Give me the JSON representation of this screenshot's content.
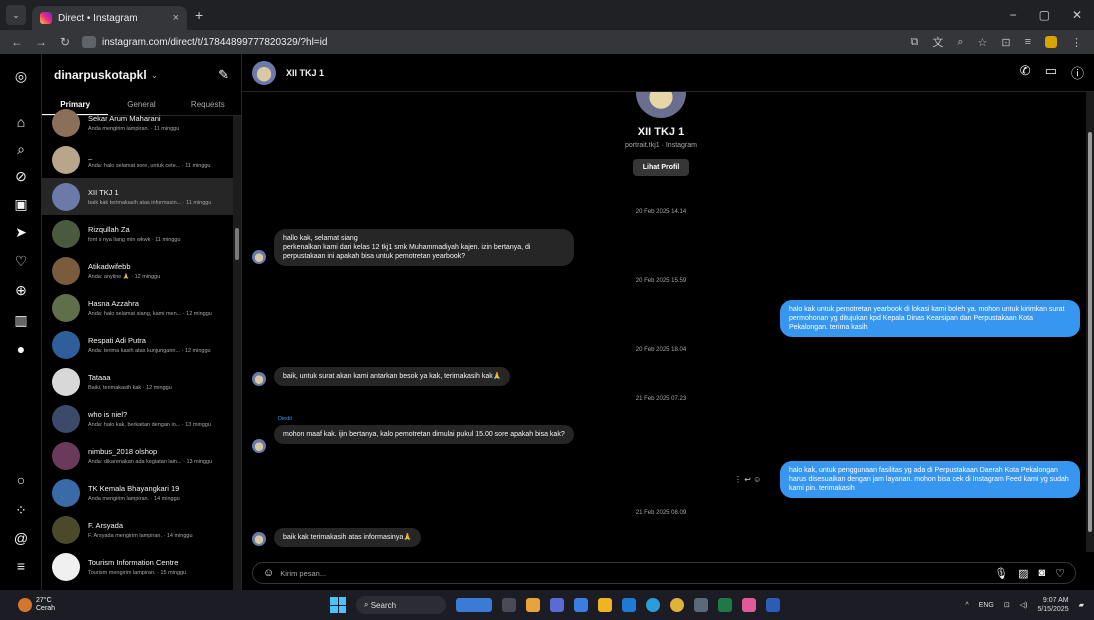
{
  "browser": {
    "tab_title": "Direct • Instagram",
    "tab_close": "×",
    "new_tab": "+",
    "url": "instagram.com/direct/t/17844899777820329/?hl=id",
    "window_controls": [
      "−",
      "▢",
      "✕"
    ]
  },
  "sidebar": {
    "account": "dinarpuskotapkl",
    "account_chevron": "⌄",
    "tabs": [
      "Primary",
      "General",
      "Requests"
    ],
    "icons": [
      "instagram-icon",
      "home-icon",
      "search-icon",
      "explore-icon",
      "reels-icon",
      "messages-icon",
      "notifications-icon",
      "create-icon",
      "dashboard-icon",
      "profile-icon",
      "threads-icon",
      "meta-icon",
      "settings-icon",
      "menu-icon"
    ],
    "threads": [
      {
        "name": "Sekar Arum Maharani",
        "preview": "Anda mengirim lampiran. · 11 minggu",
        "color": "#8a6f5a"
      },
      {
        "name": "_",
        "preview": "Anda: halo selamat sore, untuk cete... · 11 minggu",
        "color": "#b8a68c"
      },
      {
        "name": "XII TKJ 1",
        "preview": "baik kak terimakasih atas informasin... · 11 minggu",
        "color": "#6b7aa8"
      },
      {
        "name": "Rizqullah Za",
        "preview": "font s nya liang min wkwk · 11 minggu",
        "color": "#4a5a3e"
      },
      {
        "name": "Atikadwifebb",
        "preview": "Anda: anyline 🙏 · 12 minggu",
        "color": "#7a5b3e"
      },
      {
        "name": "Hasna Azzahra",
        "preview": "Anda: halo selamat siang, kami men... · 12 minggu",
        "color": "#5f6f4a"
      },
      {
        "name": "Respati Adi Putra",
        "preview": "Anda: terima kasih atas kunjungann... · 12 minggu",
        "color": "#2f5f9a"
      },
      {
        "name": "Tataaa",
        "preview": "Baiki, terimakasih kak · 12 minggu",
        "color": "#d8d8d8"
      },
      {
        "name": "who is niel?",
        "preview": "Anda: halo kak, berkaitan dengan io... · 13 minggu",
        "color": "#3c4a6a"
      },
      {
        "name": "nimbus_2018 olshop",
        "preview": "Anda: dikarenakan ada kegiatan lain... · 13 minggu",
        "color": "#6a3a5a"
      },
      {
        "name": "TK Kemala Bhayangkari 19",
        "preview": "Anda mengirim lampiran. · 14 minggu",
        "color": "#3a6aa8"
      },
      {
        "name": "F. Arsyada",
        "preview": "F. Arsyada mengirim lampiran. · 14 minggu",
        "color": "#4a4a2a"
      },
      {
        "name": "Tourism Information Centre",
        "preview": "Tourism mengirim lampiran. · 15 minggu",
        "color": "#f0f0f0"
      }
    ]
  },
  "chat": {
    "title": "XII TKJ 1",
    "profile_name": "XII TKJ 1",
    "profile_sub": "portrait.tkj1 · Instagram",
    "profile_button": "Lihat Profil",
    "timestamps": [
      "20 Feb 2025 14.14",
      "20 Feb 2025 15.59",
      "20 Feb 2025 18.04",
      "21 Feb 2025 07.23",
      "21 Feb 2025 08.09"
    ],
    "edited_label": "Diedit",
    "messages": [
      {
        "from": "them",
        "text": "hallo kak, selamat siang\nperkenalkan kami dari kelas 12 tkj1 smk Muhammadiyah kajen. izin bertanya, di perpustakaan ini apakah bisa untuk pemotretan yearbook?"
      },
      {
        "from": "me",
        "text": "halo kak untuk pemotretan yearbook di lokasi kami boleh ya. mohon untuk kirimkan surat permohonan yg ditujukan kpd Kepala Dinas Kearsipan dan Perpustakaan Kota Pekalongan. terima kasih"
      },
      {
        "from": "them",
        "text": "baik, untuk surat akan kami antarkan besok ya kak, terimakasih kak🙏"
      },
      {
        "from": "them",
        "text": "mohon maaf kak. ijin bertanya, kalo pemotretan dimulai pukul 15.00 sore apakah bisa kak?"
      },
      {
        "from": "me",
        "text": "halo kak, untuk penggunaan fasilitas yg ada di Perpustakaan Daerah Kota Pekalongan harus disesuaikan dengan jam layanan. mohon bisa cek di Instagram Feed kami yg sudah kami pin. terimakasih"
      },
      {
        "from": "them",
        "text": "baik kak terimakasih atas informasinya🙏"
      }
    ],
    "reactions": "⋮  ↩  ☺",
    "composer_placeholder": "Kirim pesan..."
  },
  "taskbar": {
    "temp": "27°C",
    "weather": "Cerah",
    "search": "Search",
    "lang": "ENG",
    "time": "9:07 AM",
    "date": "5/15/2025"
  }
}
